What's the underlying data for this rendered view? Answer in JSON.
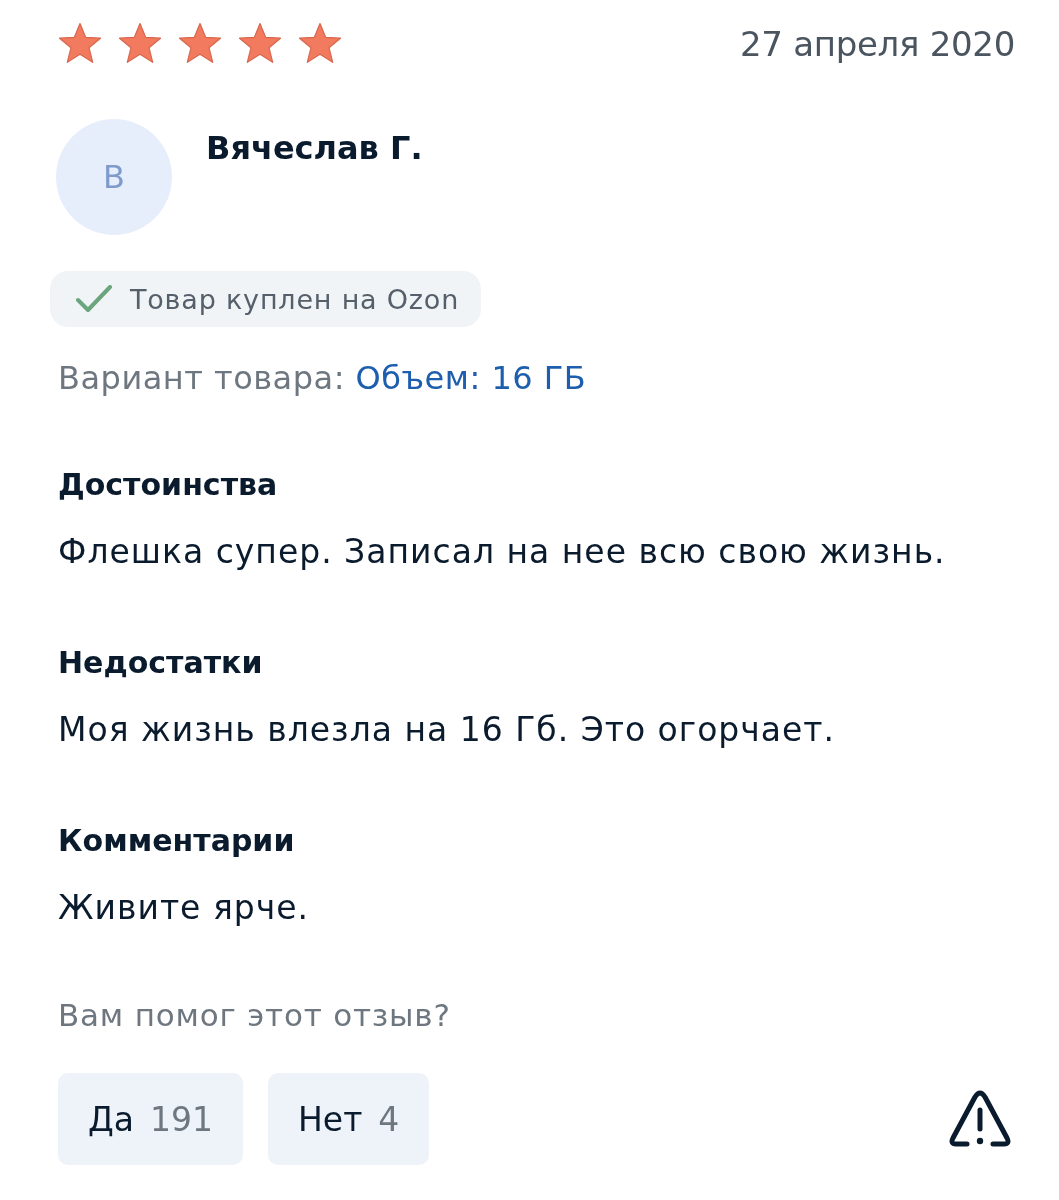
{
  "review": {
    "stars": 5,
    "date": "27 апреля 2020"
  },
  "author": {
    "avatar_letter": "В",
    "name": "Вячеслав Г."
  },
  "purchase_badge": {
    "label": "Товар куплен на Ozon"
  },
  "variant": {
    "label": "Вариант товара:",
    "value": "Объем: 16 ГБ"
  },
  "sections": [
    {
      "title": "Достоинства",
      "text": "Флешка супер. Записал на нее всю свою жизнь."
    },
    {
      "title": "Недостатки",
      "text": "Моя жизнь влезла на 16 Гб. Это огорчает."
    },
    {
      "title": "Комментарии",
      "text": "Живите ярче."
    }
  ],
  "helpful": {
    "question": "Вам помог этот отзыв?",
    "buttons": [
      {
        "label": "Да",
        "count": "191"
      },
      {
        "label": "Нет",
        "count": "4"
      }
    ]
  }
}
